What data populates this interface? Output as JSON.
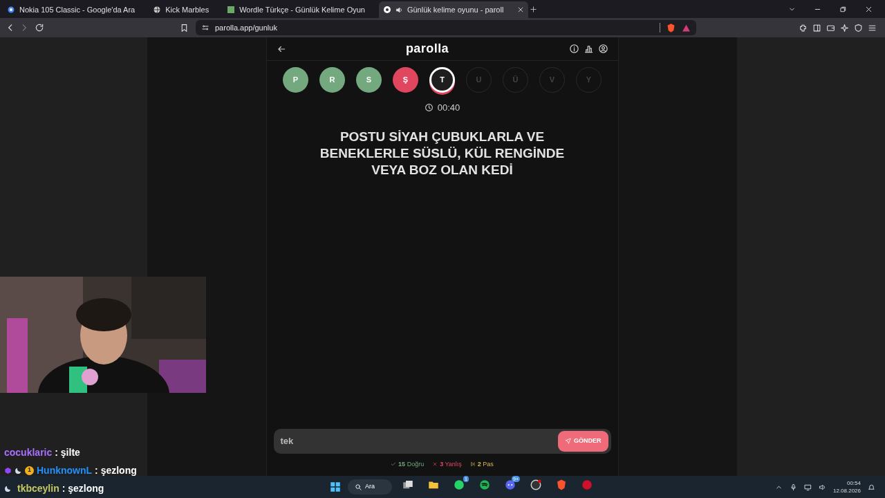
{
  "browser": {
    "tabs": [
      {
        "title": "Nokia 105 Classic - Google'da Ara",
        "selected": false
      },
      {
        "title": "Kick Marbles",
        "selected": false
      },
      {
        "title": "Wordle Türkçe - Günlük Kelime Oyun",
        "selected": false
      },
      {
        "title": "Günlük kelime oyunu - paroll",
        "selected": true
      }
    ],
    "url": "parolla.app/gunluk"
  },
  "app": {
    "title": "parolla",
    "letters": [
      {
        "letter": "P",
        "kind": "correct"
      },
      {
        "letter": "R",
        "kind": "correct"
      },
      {
        "letter": "S",
        "kind": "correct"
      },
      {
        "letter": "Ş",
        "kind": "wrong"
      },
      {
        "letter": "T",
        "kind": "current"
      },
      {
        "letter": "U",
        "kind": "pending"
      },
      {
        "letter": "Ü",
        "kind": "pending"
      },
      {
        "letter": "V",
        "kind": "pending"
      },
      {
        "letter": "Y",
        "kind": "pending"
      }
    ],
    "timer": "00:40",
    "question": "POSTU SİYAH ÇUBUKLARLA VE BENEKLERLE SÜSLÜ, KÜL RENGİNDE VEYA BOZ OLAN KEDİ",
    "answer": "tek",
    "submit": "GÖNDER",
    "stats": [
      {
        "kind": "correct",
        "count": "15",
        "label": "Doğru"
      },
      {
        "kind": "wrong",
        "count": "3",
        "label": "Yanlış"
      },
      {
        "kind": "pass",
        "count": "2",
        "label": "Pas"
      }
    ]
  },
  "chat": [
    {
      "kind": "plain",
      "user": "cocuklaric",
      "color": "#a970ff",
      "message": ": şilte"
    },
    {
      "kind": "badged",
      "user": "HunknownL",
      "color": "#1e90ff",
      "message": ": şezlong",
      "badge_count": "1"
    },
    {
      "kind": "moon",
      "user": "tkbceylin",
      "color": "#c8c864",
      "message": ": şezlong"
    }
  ],
  "taskbar": {
    "search": "Ara",
    "whatsapp_badge": "1",
    "discord_badge": "9+",
    "time": "00:54",
    "date": "12.08.2026"
  }
}
